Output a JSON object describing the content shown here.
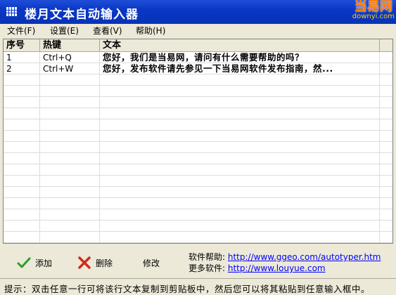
{
  "window": {
    "title": "楼月文本自动输入器",
    "logo_main": "当易网",
    "logo_sub": "downyi.com"
  },
  "menu": [
    {
      "label": "文件(F)"
    },
    {
      "label": "设置(E)"
    },
    {
      "label": "查看(V)"
    },
    {
      "label": "帮助(H)"
    }
  ],
  "table": {
    "headers": {
      "index": "序号",
      "hotkey": "热键",
      "text": "文本"
    },
    "rows": [
      {
        "index": "1",
        "hotkey": "Ctrl+Q",
        "text": "您好，我们是当易网，请问有什么需要帮助的吗？"
      },
      {
        "index": "2",
        "hotkey": "Ctrl+W",
        "text": "您好，发布软件请先参见一下当易网软件发布指南，然..."
      }
    ]
  },
  "buttons": {
    "add": "添加",
    "delete": "删除",
    "edit": "修改"
  },
  "links": {
    "help_label": "软件帮助:",
    "help_url": "http://www.ggeo.com/autotyper.htm",
    "more_label": "更多软件:",
    "more_url": "http://www.louyue.com"
  },
  "status": {
    "hint": "提示：双击任意一行可将该行文本复制到剪贴板中，然后您可以将其粘贴到任意输入框中。"
  },
  "colors": {
    "title_bar": "#0a37c4",
    "link": "#0000ff",
    "add_icon": "#2e9b2e",
    "delete_icon": "#d42a1a"
  }
}
